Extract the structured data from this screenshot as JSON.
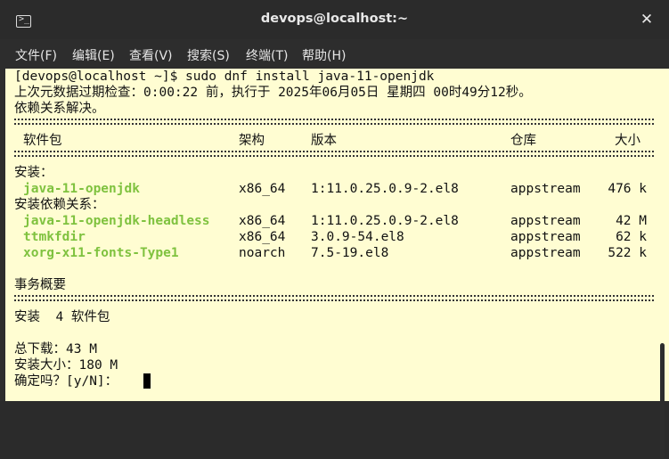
{
  "window": {
    "title": "devops@localhost:~"
  },
  "menu": [
    "文件(F)",
    "编辑(E)",
    "查看(V)",
    "搜索(S)",
    "终端(T)",
    "帮助(H)"
  ],
  "terminal": {
    "prompt_line": "[devops@localhost ~]$ sudo dnf install java-11-openjdk",
    "meta_line": "上次元数据过期检查：0:00:22 前，执行于 2025年06月05日 星期四 00时49分12秒。",
    "resolved_line": "依赖关系解决。",
    "headers": {
      "package": "软件包",
      "arch": "架构",
      "version": "版本",
      "repo": "仓库",
      "size": "大小"
    },
    "install_label": "安装：",
    "deps_label": "安装依赖关系：",
    "install_rows": [
      {
        "name": "java-11-openjdk",
        "arch": "x86_64",
        "version": "1:11.0.25.0.9-2.el8",
        "repo": "appstream",
        "size": "476 k"
      }
    ],
    "dep_rows": [
      {
        "name": "java-11-openjdk-headless",
        "arch": "x86_64",
        "version": "1:11.0.25.0.9-2.el8",
        "repo": "appstream",
        "size": "42 M"
      },
      {
        "name": "ttmkfdir",
        "arch": "x86_64",
        "version": "3.0.9-54.el8",
        "repo": "appstream",
        "size": "62 k"
      },
      {
        "name": "xorg-x11-fonts-Type1",
        "arch": "noarch",
        "version": "7.5-19.el8",
        "repo": "appstream",
        "size": "522 k"
      }
    ],
    "summary_label": "事务概要",
    "install_count_line": "安装  4 软件包",
    "total_download_line": "总下载：43 M",
    "install_size_line": "安装大小：180 M",
    "confirm_line": "确定吗？[y/N]： "
  },
  "colors": {
    "background": "#fffdd2",
    "package_name": "#7fc23f",
    "titlebar": "#2b2b2b"
  },
  "icons": {
    "window_icon": "terminal-icon",
    "close": "close-icon"
  }
}
